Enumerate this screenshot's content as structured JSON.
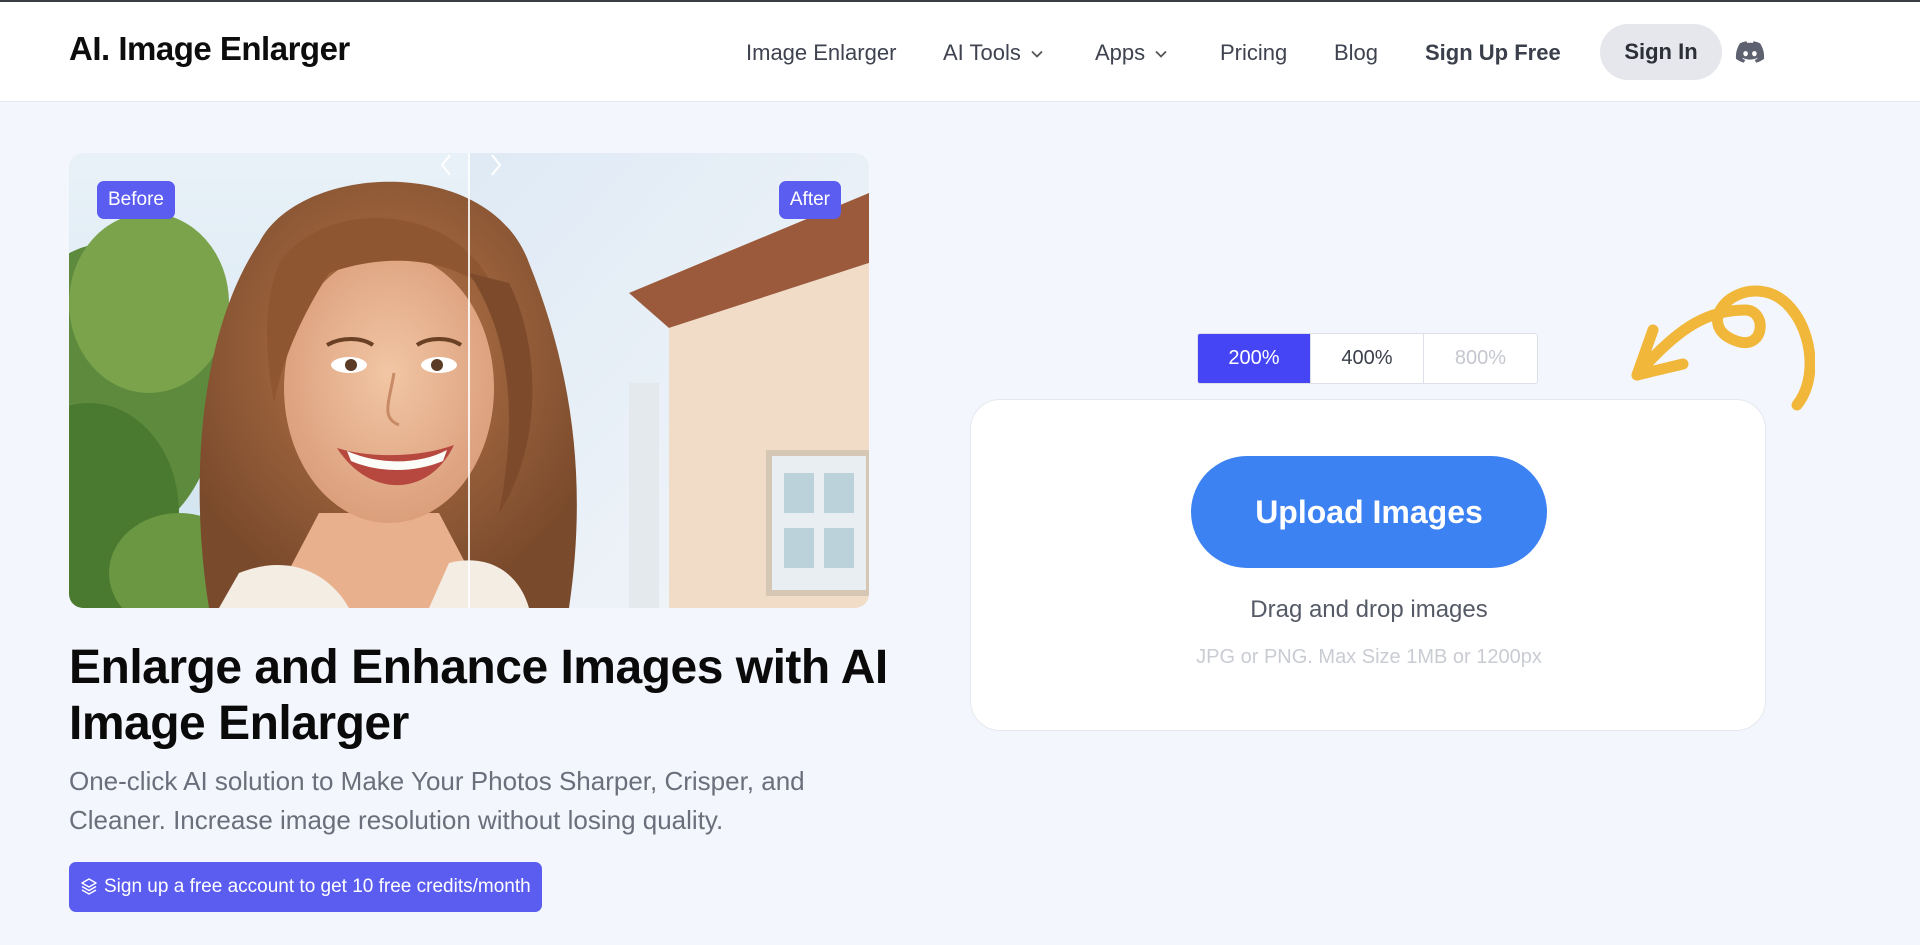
{
  "header": {
    "logo": "AI. Image Enlarger",
    "nav": {
      "image_enlarger": "Image Enlarger",
      "ai_tools": "AI Tools",
      "apps": "Apps",
      "pricing": "Pricing",
      "blog": "Blog",
      "sign_up": "Sign Up Free"
    },
    "sign_in": "Sign In"
  },
  "hero": {
    "before_label": "Before",
    "after_label": "After",
    "headline": "Enlarge and Enhance Images with AI Image Enlarger",
    "subtitle": "One-click AI solution to Make Your Photos Sharper, Crisper, and Cleaner. Increase image resolution without losing quality.",
    "promo": "Sign up a free account to get 10 free credits/month"
  },
  "upload": {
    "scales": [
      {
        "label": "200%",
        "state": "active"
      },
      {
        "label": "400%",
        "state": "normal"
      },
      {
        "label": "800%",
        "state": "disabled"
      }
    ],
    "button": "Upload Images",
    "drag_text": "Drag and drop images",
    "hint": "JPG or PNG. Max Size 1MB or 1200px"
  },
  "colors": {
    "accent_purple": "#5b5cf0",
    "upload_blue": "#3d82f2",
    "doodle_yellow": "#f1b73a",
    "page_bg": "#f4f6fd"
  }
}
